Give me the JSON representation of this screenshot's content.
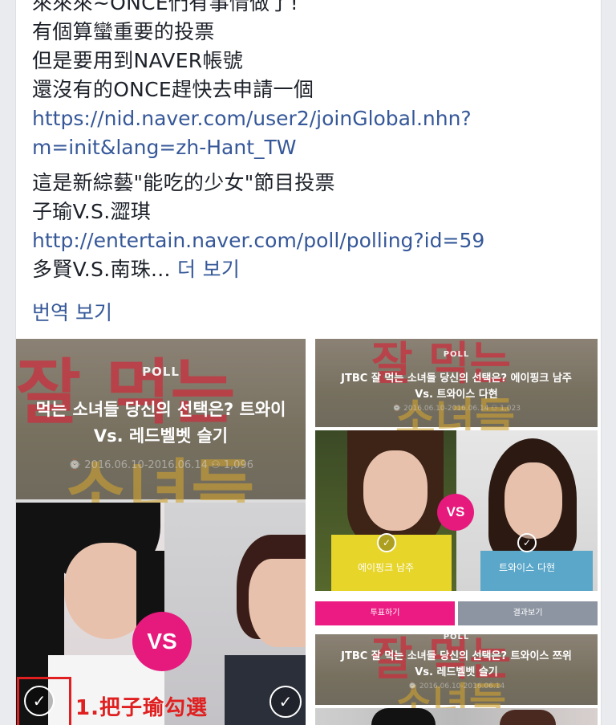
{
  "post": {
    "lines": [
      "來來來~ONCE們有事情做了!",
      "有個算蠻重要的投票",
      "但是要用到NAVER帳號",
      "還沒有的ONCE趕快去申請一個"
    ],
    "link1_line1": "https://nid.naver.com/user2/joinGlobal.nhn?",
    "link1_line2": "m=init&lang=zh-Hant_TW",
    "lines2": [
      "這是新綜藝\"能吃的少女\"節目投票",
      "子瑜V.S.澀琪"
    ],
    "link2": "http://entertain.naver.com/poll/polling?id=59",
    "last_line": "多賢V.S.南珠...",
    "see_more": "더 보기",
    "translate": "번역 보기"
  },
  "tiles": {
    "left": {
      "tag": "POLL",
      "title_line1": "먹는 소녀들 당신의 선택은? 트와이",
      "title_line2": "Vs. 레드벨벳 슬기",
      "meta": "⌚ 2016.06.10-2016.06.14   ⚇ 1,096",
      "vs": "VS"
    },
    "right_top": {
      "tag": "POLL",
      "title_line1": "JTBC 잘 먹는 소녀들 당신의 선택은? 에이핑크 남주",
      "title_line2": "Vs. 트와이스 다현",
      "meta": "⌚ 2016.06.10-2016.06.14   ⚇ 1,023",
      "vs": "VS",
      "name_left": "에이핑크 남주",
      "name_right": "트와이스 다현",
      "vote_button": "투표하기",
      "result_button": "결과보기"
    },
    "right_bottom": {
      "tag": "POLL",
      "title_line1": "JTBC 잘 먹는 소녀들 당신의 선택은? 트와이스 쯔위",
      "title_line2": "Vs. 레드벨벳 슬기",
      "meta": "⌚ 2016.06.10-2016.06.14"
    }
  },
  "annotation": {
    "text": "1.把子瑜勾選"
  },
  "colors": {
    "link": "#365899",
    "vs_pink": "#e6197d",
    "annotation_red": "#e02020"
  }
}
